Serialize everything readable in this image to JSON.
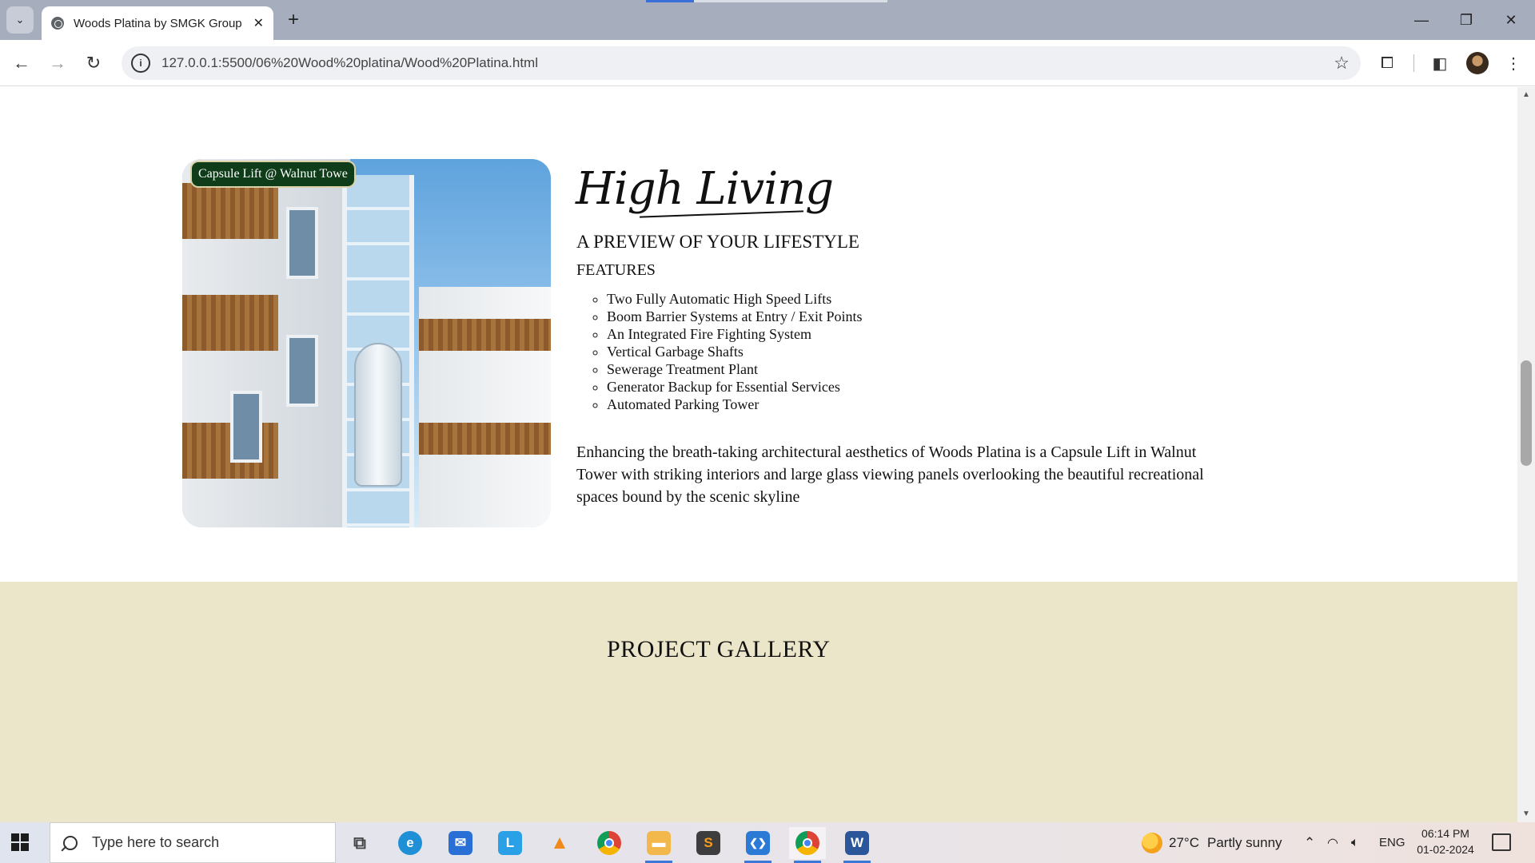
{
  "browser": {
    "tab_title": "Woods Platina by SMGK Group",
    "new_tab": "+",
    "tab_close": "✕",
    "url": "127.0.0.1:5500/06%20Wood%20platina/Wood%20Platina.html",
    "window_minimize": "—",
    "window_restore": "❐",
    "window_close": "✕"
  },
  "feature": {
    "image_badge": "Capsule Lift @ Walnut Towe",
    "heading": "High Living",
    "subtitle": "A PREVIEW OF YOUR LIFESTYLE",
    "features_label": "FEATURES",
    "features": [
      "Two Fully Automatic High Speed Lifts",
      "Boom Barrier Systems at Entry / Exit Points",
      "An Integrated Fire Fighting System",
      "Vertical Garbage Shafts",
      "Sewerage Treatment Plant",
      "Generator Backup for Essential Services",
      "Automated Parking Tower"
    ],
    "description": "Enhancing the breath-taking architectural aesthetics of Woods Platina is a Capsule Lift in Walnut Tower with striking interiors and large glass viewing panels overlooking the beautiful recreational spaces bound by the scenic skyline"
  },
  "gallery": {
    "title": "PROJECT GALLERY"
  },
  "taskbar": {
    "search_placeholder": "Type here to search",
    "weather_temp": "27°C",
    "weather_desc": "Partly sunny",
    "language": "ENG",
    "time": "06:14 PM",
    "date": "01-02-2024",
    "apps": [
      {
        "name": "task-view",
        "glyph": "⧉",
        "color": "#555555"
      },
      {
        "name": "edge",
        "glyph": "e",
        "color": "#1f8fd6"
      },
      {
        "name": "mail",
        "glyph": "✉",
        "color": "#2a6fd6"
      },
      {
        "name": "lexicon",
        "glyph": "L",
        "color": "#2aa0e6"
      },
      {
        "name": "vlc",
        "glyph": "▲",
        "color": "#f08a1c"
      },
      {
        "name": "chrome",
        "glyph": "◉",
        "color": "#db4437"
      },
      {
        "name": "file-explorer",
        "glyph": "▬",
        "color": "#f2b84b"
      },
      {
        "name": "sublime-text",
        "glyph": "S",
        "color": "#3d3d3d"
      },
      {
        "name": "vs-code",
        "glyph": "❮❯",
        "color": "#2b7bd6"
      },
      {
        "name": "chrome-active",
        "glyph": "◉",
        "color": "#db4437"
      },
      {
        "name": "word",
        "glyph": "W",
        "color": "#2b579a"
      }
    ]
  },
  "colors": {
    "tab_strip": "#a6adbd",
    "gallery_bg": "#ebe5c9",
    "badge_bg": "#0f3d1a"
  }
}
